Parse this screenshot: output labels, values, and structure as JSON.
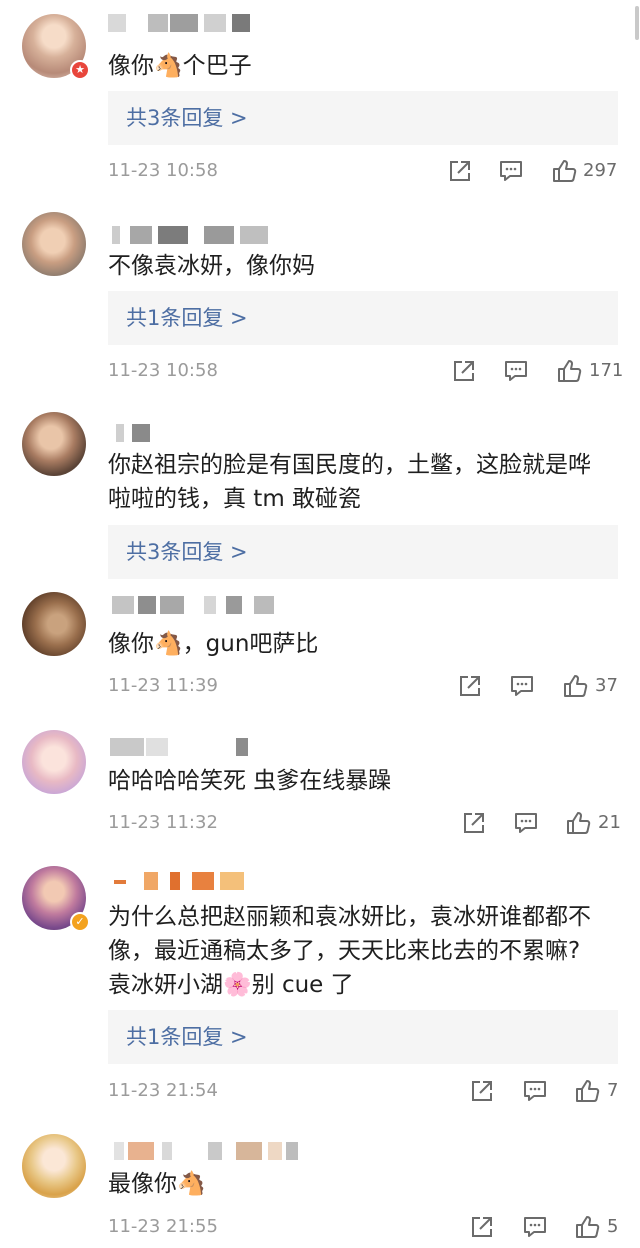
{
  "colors": {
    "text": "#1f1f1f",
    "reply_link": "#4d6ea3",
    "meta": "#9b9b9b",
    "reply_bg": "#f5f5f5"
  },
  "comments": [
    {
      "text_lines": [
        "像你🐴个巴子"
      ],
      "replies_label": "共3条回复 >",
      "time": "11-23 10:58",
      "likes": "297",
      "avatar_badge": "red-star-badge"
    },
    {
      "text_lines": [
        "不像袁冰妍，像你妈"
      ],
      "replies_label": "共1条回复 >",
      "time": "11-23 10:58",
      "likes": "171"
    },
    {
      "text_lines": [
        "你赵祖宗的脸是有国民度的，土鳖，这脸就是哗",
        "啦啦的钱，真 tm 敢碰瓷"
      ],
      "replies_label": "共3条回复 >"
    },
    {
      "text_lines": [
        "像你🐴，gun吧萨比"
      ],
      "time": "11-23 11:39",
      "likes": "37"
    },
    {
      "text_lines": [
        "哈哈哈哈笑死  虫爹在线暴躁"
      ],
      "time": "11-23 11:32",
      "likes": "21"
    },
    {
      "text_lines": [
        "为什么总把赵丽颖和袁冰妍比，袁冰妍谁都都不",
        "像，最近通稿太多了，天天比来比去的不累嘛?",
        "袁冰妍小湖🌸别 cue 了"
      ],
      "replies_label": "共1条回复 >",
      "time": "11-23 21:54",
      "likes": "7",
      "avatar_badge": "verified-badge"
    },
    {
      "text_lines": [
        "最像你🐴"
      ],
      "time": "11-23 21:55",
      "likes": "5"
    }
  ]
}
